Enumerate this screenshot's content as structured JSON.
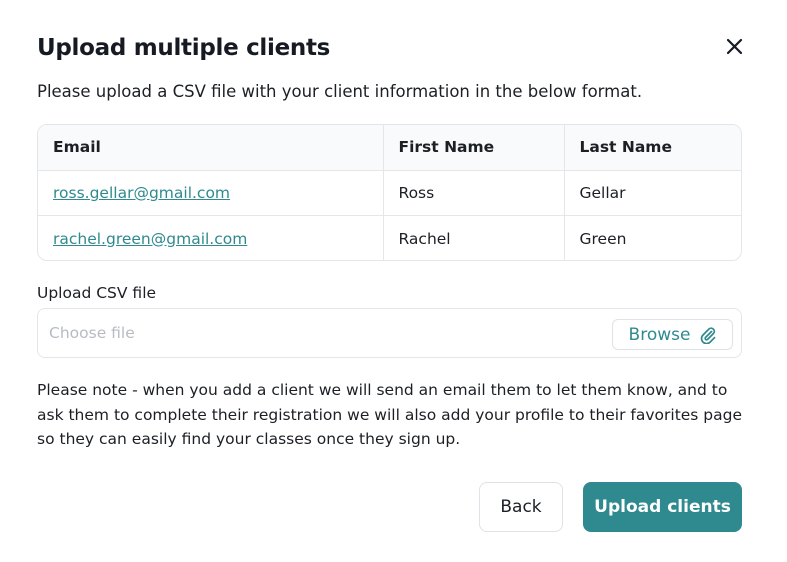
{
  "modal": {
    "title": "Upload multiple clients",
    "subtitle": "Please upload a CSV file with your client information in the below format."
  },
  "table": {
    "headers": [
      "Email",
      "First Name",
      "Last Name"
    ],
    "rows": [
      [
        "ross.gellar@gmail.com",
        "Ross",
        "Gellar"
      ],
      [
        "rachel.green@gmail.com",
        "Rachel",
        "Green"
      ]
    ]
  },
  "upload": {
    "label": "Upload CSV file",
    "placeholder": "Choose file",
    "browse_label": "Browse",
    "browse_icon": "paperclip-icon"
  },
  "note": "Please note - when you add a client we will send an email them to let them know, and to ask them to complete their registration we will also add your profile to their favorites page so they can easily find your classes once they sign up.",
  "actions": {
    "back_label": "Back",
    "upload_label": "Upload clients"
  },
  "colors": {
    "accent": "#2f8a8f",
    "text": "#1c1f24",
    "border": "#e4e6ea",
    "placeholder": "#b7bcc4"
  }
}
